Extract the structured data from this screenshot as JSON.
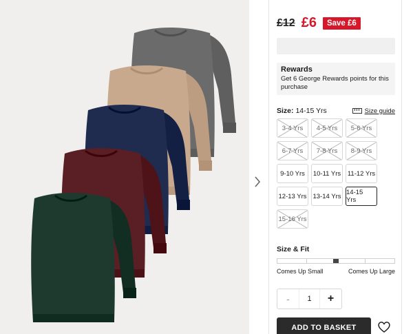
{
  "price": {
    "was": "£12",
    "now": "£6",
    "save_badge": "Save £6"
  },
  "rewards": {
    "title": "Rewards",
    "text": "Get 6 George Rewards points for this purchase"
  },
  "size": {
    "label": "Size:",
    "selected_value": "14-15 Yrs",
    "guide_label": "Size guide",
    "options": [
      {
        "label": "3-4 Yrs",
        "available": false,
        "selected": false
      },
      {
        "label": "4-5 Yrs",
        "available": false,
        "selected": false
      },
      {
        "label": "5-6 Yrs",
        "available": false,
        "selected": false
      },
      {
        "label": "6-7 Yrs",
        "available": false,
        "selected": false
      },
      {
        "label": "7-8 Yrs",
        "available": false,
        "selected": false
      },
      {
        "label": "8-9 Yrs",
        "available": false,
        "selected": false
      },
      {
        "label": "9-10 Yrs",
        "available": true,
        "selected": false
      },
      {
        "label": "10-11 Yrs",
        "available": true,
        "selected": false
      },
      {
        "label": "11-12 Yrs",
        "available": true,
        "selected": false
      },
      {
        "label": "12-13 Yrs",
        "available": true,
        "selected": false
      },
      {
        "label": "13-14 Yrs",
        "available": true,
        "selected": false
      },
      {
        "label": "14-15 Yrs",
        "available": true,
        "selected": true
      },
      {
        "label": "15-16 Yrs",
        "available": false,
        "selected": false
      }
    ]
  },
  "fit": {
    "title": "Size & Fit",
    "low_label": "Comes Up Small",
    "high_label": "Comes Up Large",
    "position": 0.5
  },
  "quantity": {
    "value": "1",
    "minus_label": "-",
    "plus_label": "+"
  },
  "cta": {
    "add_to_basket": "ADD TO BASKET"
  },
  "colors": {
    "sale_red": "#d7182a",
    "button_dark": "#2b2b2b",
    "shirts": [
      "#6b6b6b",
      "#c8a98d",
      "#1f2b4f",
      "#5a1e25",
      "#1e3a2f"
    ]
  },
  "icons": [
    "chevron-right-icon",
    "ruler-icon",
    "check-icon",
    "heart-icon"
  ]
}
